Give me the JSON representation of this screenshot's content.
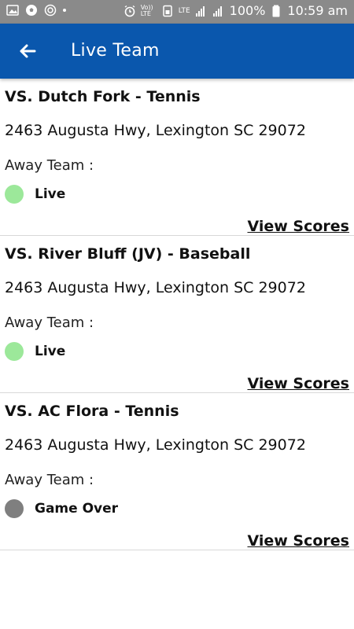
{
  "statusbar": {
    "battery": "100%",
    "time": "10:59 am",
    "net1": "Vo)) LTE",
    "net2": "LTE"
  },
  "appbar": {
    "title": "Live Team"
  },
  "colors": {
    "appbar": "#0a57ad",
    "live": "#9ce89a",
    "over": "#7f7f7f"
  },
  "games": [
    {
      "title": "VS. Dutch Fork - Tennis",
      "address": "2463 Augusta Hwy, Lexington SC 29072",
      "away_label": "Away Team :",
      "status": "Live",
      "link": "View Scores"
    },
    {
      "title": "VS. River Bluff (JV) - Baseball",
      "address": "2463 Augusta Hwy, Lexington SC 29072",
      "away_label": "Away Team :",
      "status": "Live",
      "link": "View Scores"
    },
    {
      "title": "VS. AC Flora - Tennis",
      "address": "2463 Augusta Hwy, Lexington SC 29072",
      "away_label": "Away Team :",
      "status": "Game Over",
      "link": "View Scores"
    }
  ]
}
